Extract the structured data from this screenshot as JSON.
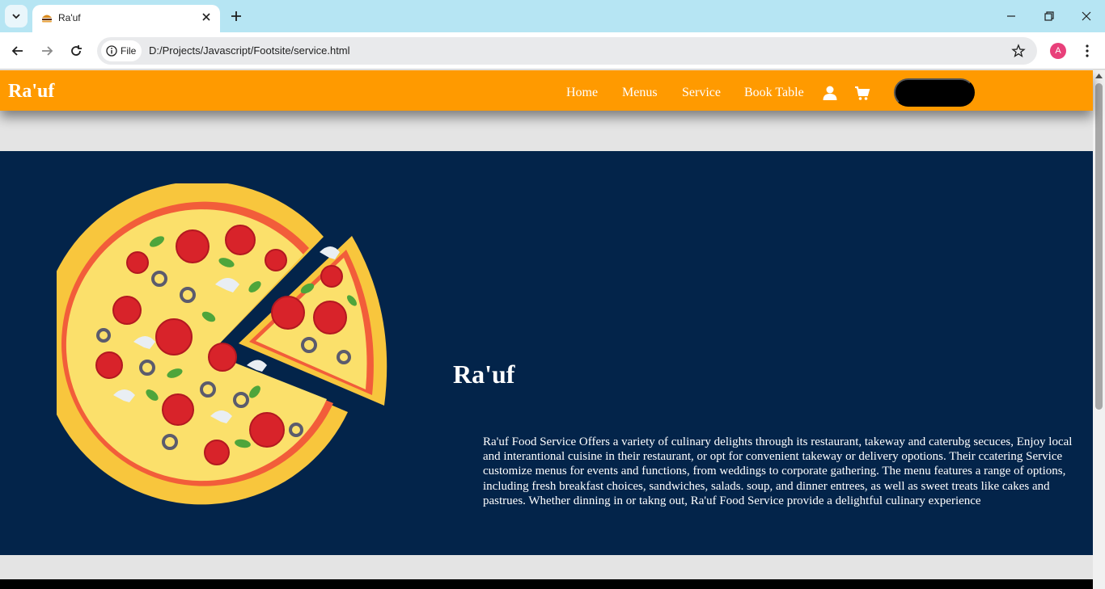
{
  "browser": {
    "tab": {
      "title": "Ra'uf"
    },
    "address": {
      "chip_label": "File",
      "url": "D:/Projects/Javascript/Footsite/service.html"
    },
    "profile_initial": "A"
  },
  "site": {
    "brand": "Ra'uf",
    "nav": [
      {
        "label": "Home"
      },
      {
        "label": "Menus"
      },
      {
        "label": "Service"
      },
      {
        "label": "Book Table"
      }
    ],
    "order_button_label": ""
  },
  "hero": {
    "title": "Ra'uf",
    "description": "Ra'uf Food Service Offers a variety of culinary delights through its restaurant, takeway and caterubg secuces, Enjoy local and interantional cuisine in their restaurant, or opt for convenient takeway or delivery opotions. Their ccatering Service customize menus for events and functions, from weddings to corporate gathering. The menu features a range of options, including fresh breakfast choices, sandwiches, salads. soup, and dinner entrees, as well as sweet treats like cakes and pastrues. Whether dinning in or takng out, Ra'uf Food Service provide a delightful culinary experience",
    "image": "pizza-illustration"
  },
  "colors": {
    "header_bg": "#ff9a00",
    "hero_bg": "#03244a",
    "page_bg": "#e4e4e4",
    "tabbar_bg": "#b6e5f3"
  }
}
